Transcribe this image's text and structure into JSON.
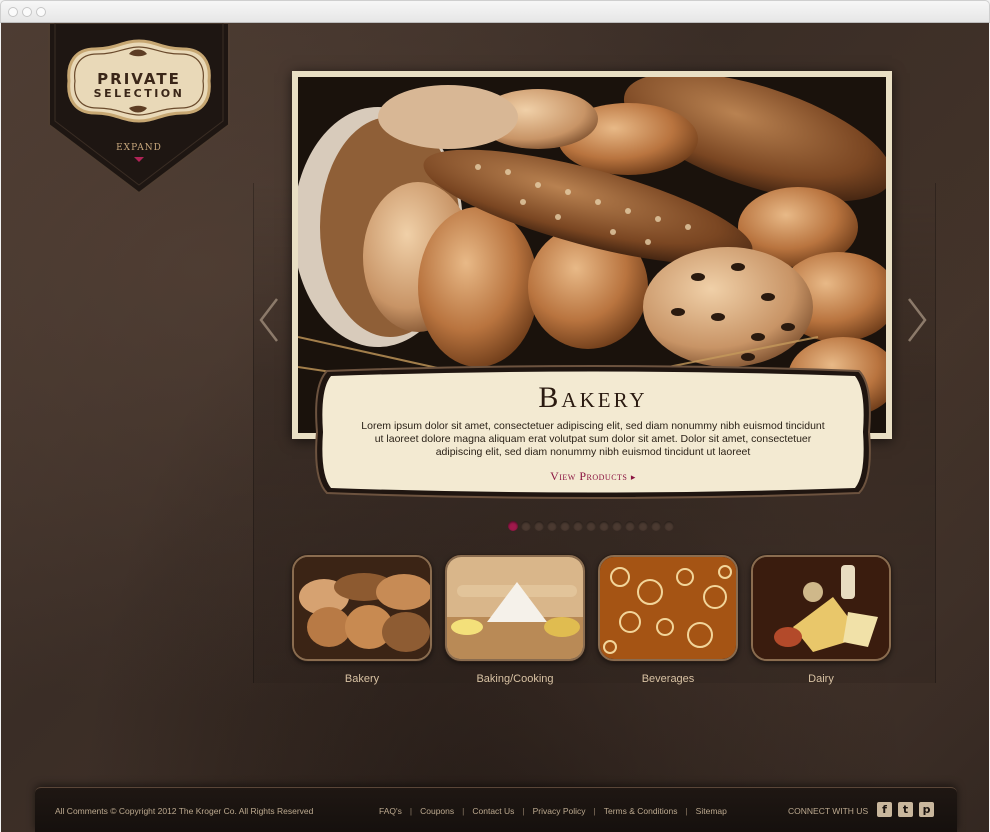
{
  "logo": {
    "line1": "PRIVATE",
    "line2": "SELECTION",
    "expand_label": "EXPAND"
  },
  "hero": {
    "title": "Bakery",
    "body": "Lorem ipsum dolor sit amet, consectetuer adipiscing elit, sed diam nonummy nibh euismod tincidunt ut laoreet dolore magna aliquam erat volutpat sum dolor sit amet. Dolor sit amet, consectetuer adipiscing elit, sed diam nonummy nibh euismod tincidunt ut laoreet",
    "link_label": "View Products",
    "link_arrow": "▸",
    "prev_icon": "chevron-left-icon",
    "next_icon": "chevron-right-icon"
  },
  "pager": {
    "count": 13,
    "active_index": 0
  },
  "categories": [
    {
      "label": "Bakery",
      "icon": "bread-thumbnail"
    },
    {
      "label": "Baking/Cooking",
      "icon": "flour-thumbnail"
    },
    {
      "label": "Beverages",
      "icon": "bubbles-thumbnail"
    },
    {
      "label": "Dairy",
      "icon": "cheese-thumbnail"
    }
  ],
  "footer": {
    "copyright": "All Comments © Copyright 2012 The Kroger Co. All Rights Reserved",
    "links": [
      "FAQ's",
      "Coupons",
      "Contact Us",
      "Privacy Policy",
      "Terms & Conditions",
      "Sitemap"
    ],
    "connect_label": "CONNECT WITH US",
    "social": [
      {
        "icon": "facebook-icon",
        "glyph": "f"
      },
      {
        "icon": "twitter-icon",
        "glyph": "t"
      },
      {
        "icon": "pinterest-icon",
        "glyph": "p"
      }
    ]
  },
  "colors": {
    "accent": "#a0194c",
    "background": "#3f3129",
    "card": "#f3ead2",
    "label_text": "#d8c2a3"
  }
}
